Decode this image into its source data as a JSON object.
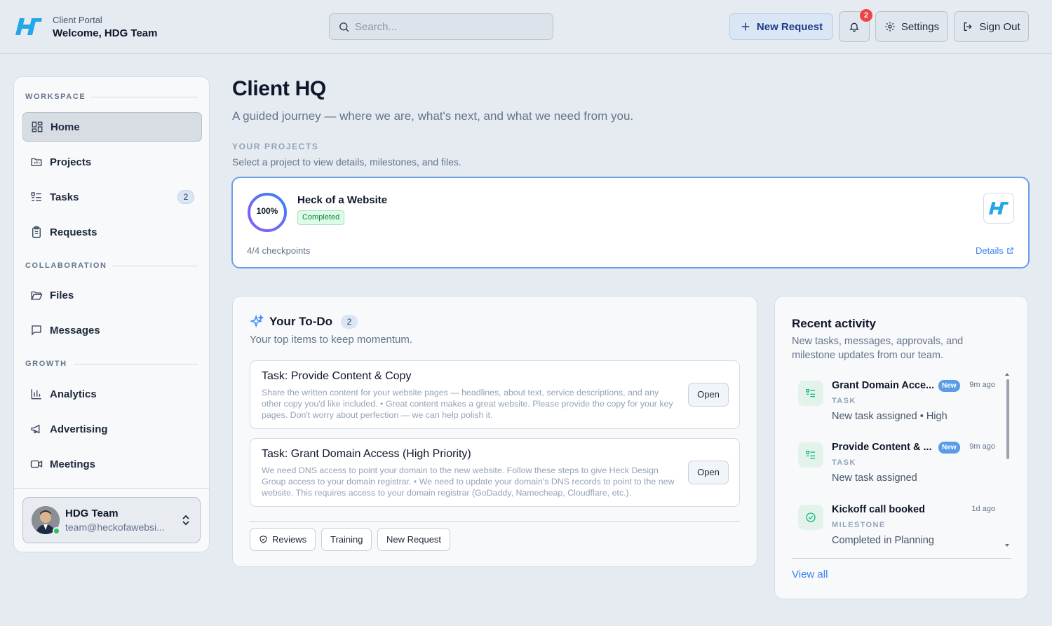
{
  "header": {
    "portal_label": "Client Portal",
    "welcome": "Welcome, HDG Team",
    "search_placeholder": "Search...",
    "new_request": "New Request",
    "notification_count": "2",
    "settings": "Settings",
    "sign_out": "Sign Out"
  },
  "sidebar": {
    "sections": {
      "workspace": "WORKSPACE",
      "collaboration": "COLLABORATION",
      "growth": "GROWTH"
    },
    "items": {
      "home": "Home",
      "projects": "Projects",
      "tasks": "Tasks",
      "tasks_badge": "2",
      "requests": "Requests",
      "files": "Files",
      "messages": "Messages",
      "analytics": "Analytics",
      "advertising": "Advertising",
      "meetings": "Meetings"
    },
    "user": {
      "name": "HDG Team",
      "email": "team@heckofawebsi..."
    }
  },
  "main": {
    "title": "Client HQ",
    "subtitle": "A guided journey — where we are, what's next, and what we need from you.",
    "projects_label": "YOUR PROJECTS",
    "projects_sub": "Select a project to view details, milestones, and files.",
    "project": {
      "progress_text": "100%",
      "progress": 1.0,
      "name": "Heck of a Website",
      "status": "Completed",
      "checkpoints": "4/4 checkpoints",
      "details": "Details"
    }
  },
  "todo": {
    "title": "Your To-Do",
    "count": "2",
    "subtitle": "Your top items to keep momentum.",
    "tasks": [
      {
        "title": "Task: Provide Content & Copy",
        "desc": "Share the written content for your website pages — headlines, about text, service descriptions, and any other copy you'd like included. • Great content makes a great website. Please provide the copy for your key pages. Don't worry about perfection — we can help polish it.",
        "action": "Open"
      },
      {
        "title": "Task: Grant Domain Access (High Priority)",
        "desc": "We need DNS access to point your domain to the new website. Follow these steps to give Heck Design Group access to your domain registrar. • We need to update your domain's DNS records to point to the new website. This requires access to your domain registrar (GoDaddy, Namecheap, Cloudflare, etc.).",
        "action": "Open"
      }
    ],
    "chips": {
      "reviews": "Reviews",
      "training": "Training",
      "new_request": "New Request"
    }
  },
  "activity": {
    "title": "Recent activity",
    "subtitle": "New tasks, messages, approvals, and milestone updates from our team.",
    "items": [
      {
        "name": "Grant Domain Acce...",
        "badge": "New",
        "time": "9m ago",
        "type": "TASK",
        "detail": "New task assigned • High"
      },
      {
        "name": "Provide Content & ...",
        "badge": "New",
        "time": "9m ago",
        "type": "TASK",
        "detail": "New task assigned"
      },
      {
        "name": "Kickoff call booked",
        "badge": "",
        "time": "1d ago",
        "type": "MILESTONE",
        "detail": "Completed in Planning"
      }
    ],
    "view_all": "View all"
  },
  "colors": {
    "accent": "#3b82f6",
    "brand": "#1e9fe0",
    "success": "#15803d",
    "danger": "#ef4444"
  }
}
